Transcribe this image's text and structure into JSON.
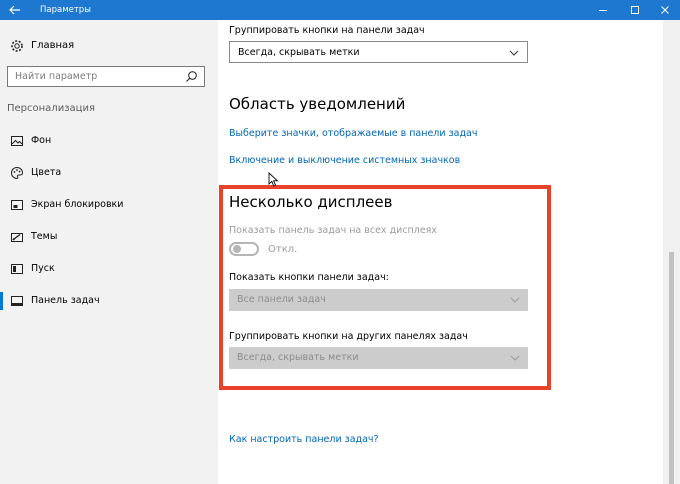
{
  "window": {
    "title": "Параметры",
    "accent": "#1e78d0"
  },
  "sidebar": {
    "home_label": "Главная",
    "search_placeholder": "Найти параметр",
    "section_header": "Персонализация",
    "items": [
      {
        "label": "Фон",
        "icon": "image-icon"
      },
      {
        "label": "Цвета",
        "icon": "palette-icon"
      },
      {
        "label": "Экран блокировки",
        "icon": "lock-screen-icon"
      },
      {
        "label": "Темы",
        "icon": "themes-icon"
      },
      {
        "label": "Пуск",
        "icon": "start-icon"
      },
      {
        "label": "Панель задач",
        "icon": "taskbar-icon",
        "selected": true
      }
    ]
  },
  "main": {
    "group_buttons_label": "Группировать кнопки на панели задач",
    "group_buttons_value": "Всегда, скрывать метки",
    "notification_area": {
      "heading": "Область уведомлений",
      "link1": "Выберите значки, отображаемые в панели задач",
      "link2": "Включение и выключение системных значков"
    },
    "multiple_displays": {
      "heading": "Несколько дисплеев",
      "show_all_label": "Показать панель задач на всех дисплеях",
      "toggle_state": "Откл.",
      "show_buttons_label": "Показать кнопки панели задач:",
      "show_buttons_value": "Все панели задач",
      "group_other_label": "Группировать кнопки на других панелях задач",
      "group_other_value": "Всегда, скрывать метки"
    },
    "help_link": "Как настроить панели задач?"
  },
  "colors": {
    "link": "#0066b8",
    "highlight": "#e8422b",
    "selection": "#0078d7"
  }
}
